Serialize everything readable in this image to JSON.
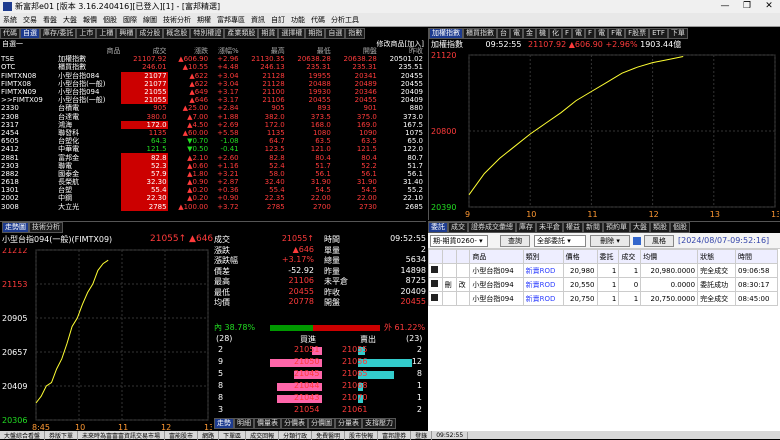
{
  "window": {
    "title": "新富邦e01 [版本 3.16.240416][已登入][1] - [富邦精選]",
    "min": "—",
    "max": "❐",
    "close": "✕"
  },
  "menu": [
    "系統",
    "交易",
    "看盤",
    "大盤",
    "報價",
    "個股",
    "國際",
    "線圖",
    "技術分析",
    "期權",
    "富邦專區",
    "資訊",
    "自訂",
    "功能",
    "代碼",
    "分析工具"
  ],
  "quote_tabs": [
    "代碼",
    "自選",
    "庫存/委託",
    "上市",
    "上櫃",
    "興櫃",
    "成分股",
    "概念股",
    "特別權證",
    "產業類股",
    "期貨",
    "選擇權",
    "期指",
    "自選",
    "指數"
  ],
  "quote_tabs_active": 1,
  "group_label": "自選一",
  "modify_label": "修改商品[加入]",
  "quote_headers": [
    "商品",
    "成交",
    "漲跌",
    "漲幅%",
    "最高",
    "最低",
    "開盤",
    "昨收"
  ],
  "quote_rows": [
    {
      "code": "TSE",
      "name": "加權指數",
      "price": "21107.92",
      "pc": "red",
      "chg": "606.90",
      "dir": "up",
      "pct": "+2.96",
      "high": "21130.35",
      "low": "20638.28",
      "open": "20638.28",
      "prev": "20501.02"
    },
    {
      "code": "OTC",
      "name": "櫃買指數",
      "price": "246.01",
      "pc": "red",
      "chg": "10.55",
      "dir": "up",
      "pct": "+4.48",
      "high": "246.13",
      "low": "235.31",
      "open": "235.31",
      "prev": "235.51"
    },
    {
      "code": "FIMTXN08",
      "name": "小型台指084",
      "price": "21077",
      "pc": "hl-red",
      "chg": "622",
      "dir": "up",
      "pct": "+3.04",
      "high": "21128",
      "low": "19955",
      "open": "20341",
      "prev": "20455"
    },
    {
      "code": "FIMTX08",
      "name": "小型台指(一般)",
      "price": "21077",
      "pc": "hl-red",
      "chg": "622",
      "dir": "up",
      "pct": "+3.04",
      "high": "21128",
      "low": "20488",
      "open": "20489",
      "prev": "20455"
    },
    {
      "code": "FIMTXN09",
      "name": "小型台指094",
      "price": "21055",
      "pc": "hl-red",
      "chg": "649",
      "dir": "up",
      "pct": "+3.17",
      "high": "21100",
      "low": "19930",
      "open": "20346",
      "prev": "20409"
    },
    {
      "code": ">>FIMTX09",
      "name": "小型台指(一般)",
      "price": "21055",
      "pc": "hl-red",
      "chg": "646",
      "dir": "up",
      "pct": "+3.17",
      "high": "21106",
      "low": "20455",
      "open": "20455",
      "prev": "20409"
    },
    {
      "code": "2330",
      "name": "台積電",
      "price": "905",
      "pc": "red",
      "chg": "25.00",
      "dir": "up",
      "pct": "+2.84",
      "high": "905",
      "low": "893",
      "open": "901",
      "prev": "880"
    },
    {
      "code": "2308",
      "name": "台達電",
      "price": "380.0",
      "pc": "red",
      "chg": "7.00",
      "dir": "up",
      "pct": "+1.88",
      "high": "382.0",
      "low": "373.5",
      "open": "375.0",
      "prev": "373.0"
    },
    {
      "code": "2317",
      "name": "鴻海",
      "price": "172.0",
      "pc": "hl-red",
      "chg": "4.50",
      "dir": "up",
      "pct": "+2.69",
      "high": "172.0",
      "low": "168.0",
      "open": "169.0",
      "prev": "167.5"
    },
    {
      "code": "2454",
      "name": "聯發科",
      "price": "1135",
      "pc": "red",
      "chg": "60.00",
      "dir": "up",
      "pct": "+5.58",
      "high": "1135",
      "low": "1080",
      "open": "1090",
      "prev": "1075"
    },
    {
      "code": "6505",
      "name": "台塑化",
      "price": "64.3",
      "pc": "green",
      "chg": "0.70",
      "dir": "down",
      "pct": "-1.08",
      "high": "64.7",
      "low": "63.5",
      "open": "63.5",
      "prev": "65.0"
    },
    {
      "code": "2412",
      "name": "中華電",
      "price": "121.5",
      "pc": "green",
      "chg": "0.50",
      "dir": "down",
      "pct": "-0.41",
      "high": "123.5",
      "low": "121.0",
      "open": "121.5",
      "prev": "122.0"
    },
    {
      "code": "2881",
      "name": "富邦金",
      "price": "82.8",
      "pc": "hl-red",
      "chg": "2.10",
      "dir": "up",
      "pct": "+2.60",
      "high": "82.8",
      "low": "80.4",
      "open": "80.4",
      "prev": "80.7"
    },
    {
      "code": "2303",
      "name": "聯電",
      "price": "52.3",
      "pc": "hl-red",
      "chg": "0.60",
      "dir": "up",
      "pct": "+1.16",
      "high": "52.4",
      "low": "51.7",
      "open": "52.2",
      "prev": "51.7"
    },
    {
      "code": "2882",
      "name": "國泰金",
      "price": "57.9",
      "pc": "hl-red",
      "chg": "1.80",
      "dir": "up",
      "pct": "+3.21",
      "high": "58.0",
      "low": "56.1",
      "open": "56.1",
      "prev": "56.1"
    },
    {
      "code": "2618",
      "name": "長榮航",
      "price": "32.30",
      "pc": "hl-red",
      "chg": "0.90",
      "dir": "up",
      "pct": "+2.87",
      "high": "32.40",
      "low": "31.90",
      "open": "31.90",
      "prev": "31.40"
    },
    {
      "code": "1301",
      "name": "台塑",
      "price": "55.4",
      "pc": "hl-red",
      "chg": "0.20",
      "dir": "up",
      "pct": "+0.36",
      "high": "55.4",
      "low": "54.5",
      "open": "54.5",
      "prev": "55.2"
    },
    {
      "code": "2002",
      "name": "中鋼",
      "price": "22.30",
      "pc": "hl-red",
      "chg": "0.20",
      "dir": "up",
      "pct": "+0.90",
      "high": "22.35",
      "low": "22.00",
      "open": "22.00",
      "prev": "22.10"
    },
    {
      "code": "3008",
      "name": "大立光",
      "price": "2785",
      "pc": "hl-red",
      "chg": "100.00",
      "dir": "up",
      "pct": "+3.72",
      "high": "2785",
      "low": "2700",
      "open": "2730",
      "prev": "2685"
    }
  ],
  "idx_tabs": [
    "加權指數",
    "櫃買指數",
    "台",
    "電",
    "金",
    "機",
    "化",
    "F",
    "電",
    "F",
    "電",
    "F電",
    "F股票",
    "ETF",
    "下單"
  ],
  "idx_head": {
    "name": "加權指數",
    "time": "09:52:55",
    "price": "21107.92",
    "chg": "606.90",
    "pct": "+2.96%",
    "vol": "1903.44億"
  },
  "idx_y_labels": [
    "21120",
    "20800",
    "20390"
  ],
  "idx_x_labels": [
    "9",
    "10",
    "11",
    "12",
    "13",
    "13:30"
  ],
  "idx_line": [
    [
      0.0,
      0.92
    ],
    [
      0.05,
      0.78
    ],
    [
      0.1,
      0.68
    ],
    [
      0.15,
      0.6
    ],
    [
      0.2,
      0.52
    ],
    [
      0.25,
      0.45
    ],
    [
      0.3,
      0.38
    ],
    [
      0.35,
      0.3
    ],
    [
      0.4,
      0.24
    ],
    [
      0.45,
      0.18
    ],
    [
      0.5,
      0.12
    ],
    [
      0.55,
      0.08
    ],
    [
      0.6,
      0.05
    ],
    [
      0.65,
      0.03
    ],
    [
      0.7,
      0.01
    ]
  ],
  "fut": {
    "title": "小型台指094(一般)(FIMTX09)",
    "price": "21055",
    "chg": "646",
    "y_labels": [
      "21212",
      "21153",
      "20905",
      "20657",
      "20409",
      "20306"
    ],
    "x_labels": [
      "8:45",
      "10",
      "11",
      "12",
      "13:45"
    ]
  },
  "fut_line": [
    [
      0.0,
      0.9
    ],
    [
      0.03,
      0.86
    ],
    [
      0.06,
      0.8
    ],
    [
      0.09,
      0.78
    ],
    [
      0.12,
      0.7
    ],
    [
      0.15,
      0.64
    ],
    [
      0.18,
      0.55
    ],
    [
      0.21,
      0.45
    ],
    [
      0.24,
      0.4
    ],
    [
      0.27,
      0.32
    ],
    [
      0.3,
      0.25
    ],
    [
      0.33,
      0.2
    ],
    [
      0.36,
      0.12
    ],
    [
      0.39,
      0.08
    ],
    [
      0.42,
      0.06
    ]
  ],
  "fut_tabs": [
    "走勢圖",
    "技術分析"
  ],
  "stats": [
    {
      "l": "成交",
      "v": "21055↑",
      "vc": "red",
      "l2": "時間",
      "v2": "09:52:55",
      "v2c": "white"
    },
    {
      "l": "漲跌",
      "v": "▲646",
      "vc": "red",
      "l2": "單量",
      "v2": "2",
      "v2c": "white"
    },
    {
      "l": "漲跌幅",
      "v": "+3.17%",
      "vc": "red",
      "l2": "總量",
      "v2": "5634",
      "v2c": "white"
    },
    {
      "l": "價差",
      "v": "-52.92",
      "vc": "white",
      "l2": "昨量",
      "v2": "14898",
      "v2c": "white"
    },
    {
      "l": "最高",
      "v": "21106",
      "vc": "red",
      "l2": "未平倉",
      "v2": "8725",
      "v2c": "white"
    },
    {
      "l": "最低",
      "v": "20455",
      "vc": "red",
      "l2": "昨收",
      "v2": "20409",
      "v2c": "white"
    },
    {
      "l": "均價",
      "v": "20778",
      "vc": "red",
      "l2": "開盤",
      "v2": "20455",
      "v2c": "red"
    }
  ],
  "ratio": {
    "in_label": "內",
    "in_pct": "38.78%",
    "out_label": "外",
    "out_pct": "61.22%",
    "in_frac": 0.3878
  },
  "book": {
    "hdr_left": "(28)",
    "hdr_bid": "買進",
    "hdr_ask": "賣出",
    "hdr_right": "(23)",
    "rows": [
      {
        "bq": "2",
        "bp": "21051",
        "ap": "21055",
        "aq": "2"
      },
      {
        "bq": "9",
        "bp": "21050",
        "ap": "21056",
        "aq": "12"
      },
      {
        "bq": "5",
        "bp": "21045",
        "ap": "21065",
        "aq": "8"
      },
      {
        "bq": "8",
        "bp": "21044",
        "ap": "21068",
        "aq": "1"
      },
      {
        "bq": "8",
        "bp": "21043",
        "ap": "21070",
        "aq": "1"
      },
      {
        "bq": "3",
        "bp": "21054",
        "ap": "21061",
        "aq": "2"
      }
    ],
    "bid_fracs": [
      0.15,
      0.75,
      0.4,
      0.65,
      0.65,
      0
    ],
    "ask_fracs": [
      0.12,
      0.9,
      0.6,
      0.08,
      0.08,
      0
    ]
  },
  "bottom_tabs": [
    "走勢",
    "明細",
    "價量表",
    "分價表",
    "分價圖",
    "分量表",
    "支撐壓力"
  ],
  "order_tabs": [
    "委託",
    "成交",
    "證券成交彙總",
    "庫存",
    "未平倉",
    "權益",
    "新閱",
    "預約單",
    "大盤",
    "類股",
    "個股"
  ],
  "order_ctrl": {
    "acct": "期-期貨0260-",
    "query": "查詢",
    "filter": "全部委託",
    "delete": "刪除",
    "risk": "風格",
    "date": "[2024/08/07-09:52:16]"
  },
  "order_headers": [
    "商品",
    "類別",
    "價格",
    "委託",
    "成交",
    "均價",
    "狀態",
    "時間"
  ],
  "orders": [
    {
      "sel": "",
      "act1": "",
      "act2": "",
      "prod": "小型台指094",
      "type": "新賣ROD",
      "price": "20,980",
      "qty": "1",
      "filled": "1",
      "avg": "20,980.0000",
      "status": "完全成交",
      "time": "09:06:58"
    },
    {
      "sel": "",
      "act1": "刪",
      "act2": "改",
      "prod": "小型台指094",
      "type": "新賣ROD",
      "price": "20,550",
      "qty": "1",
      "filled": "0",
      "avg": "0.0000",
      "status": "委託成功",
      "time": "08:30:17"
    },
    {
      "sel": "",
      "act1": "",
      "act2": "",
      "prod": "小型台指094",
      "type": "新賣ROD",
      "price": "20,750",
      "qty": "1",
      "filled": "1",
      "avg": "20,750.0000",
      "status": "完全成交",
      "time": "08:45:00"
    }
  ],
  "status": [
    "大盤綜合看盤",
    "券版下單",
    "未來時為富富富資訊交易市場",
    "富能股市",
    "網路",
    "下單區",
    "成交回報",
    "分類行政",
    "免費醫明",
    "股市快報",
    "富邦證券",
    "登錄",
    "09:52:55"
  ],
  "colors": {
    "up": "#ff3b3b",
    "down": "#22dd22",
    "accent": "#1d3b8f",
    "line": "#ffff33"
  }
}
